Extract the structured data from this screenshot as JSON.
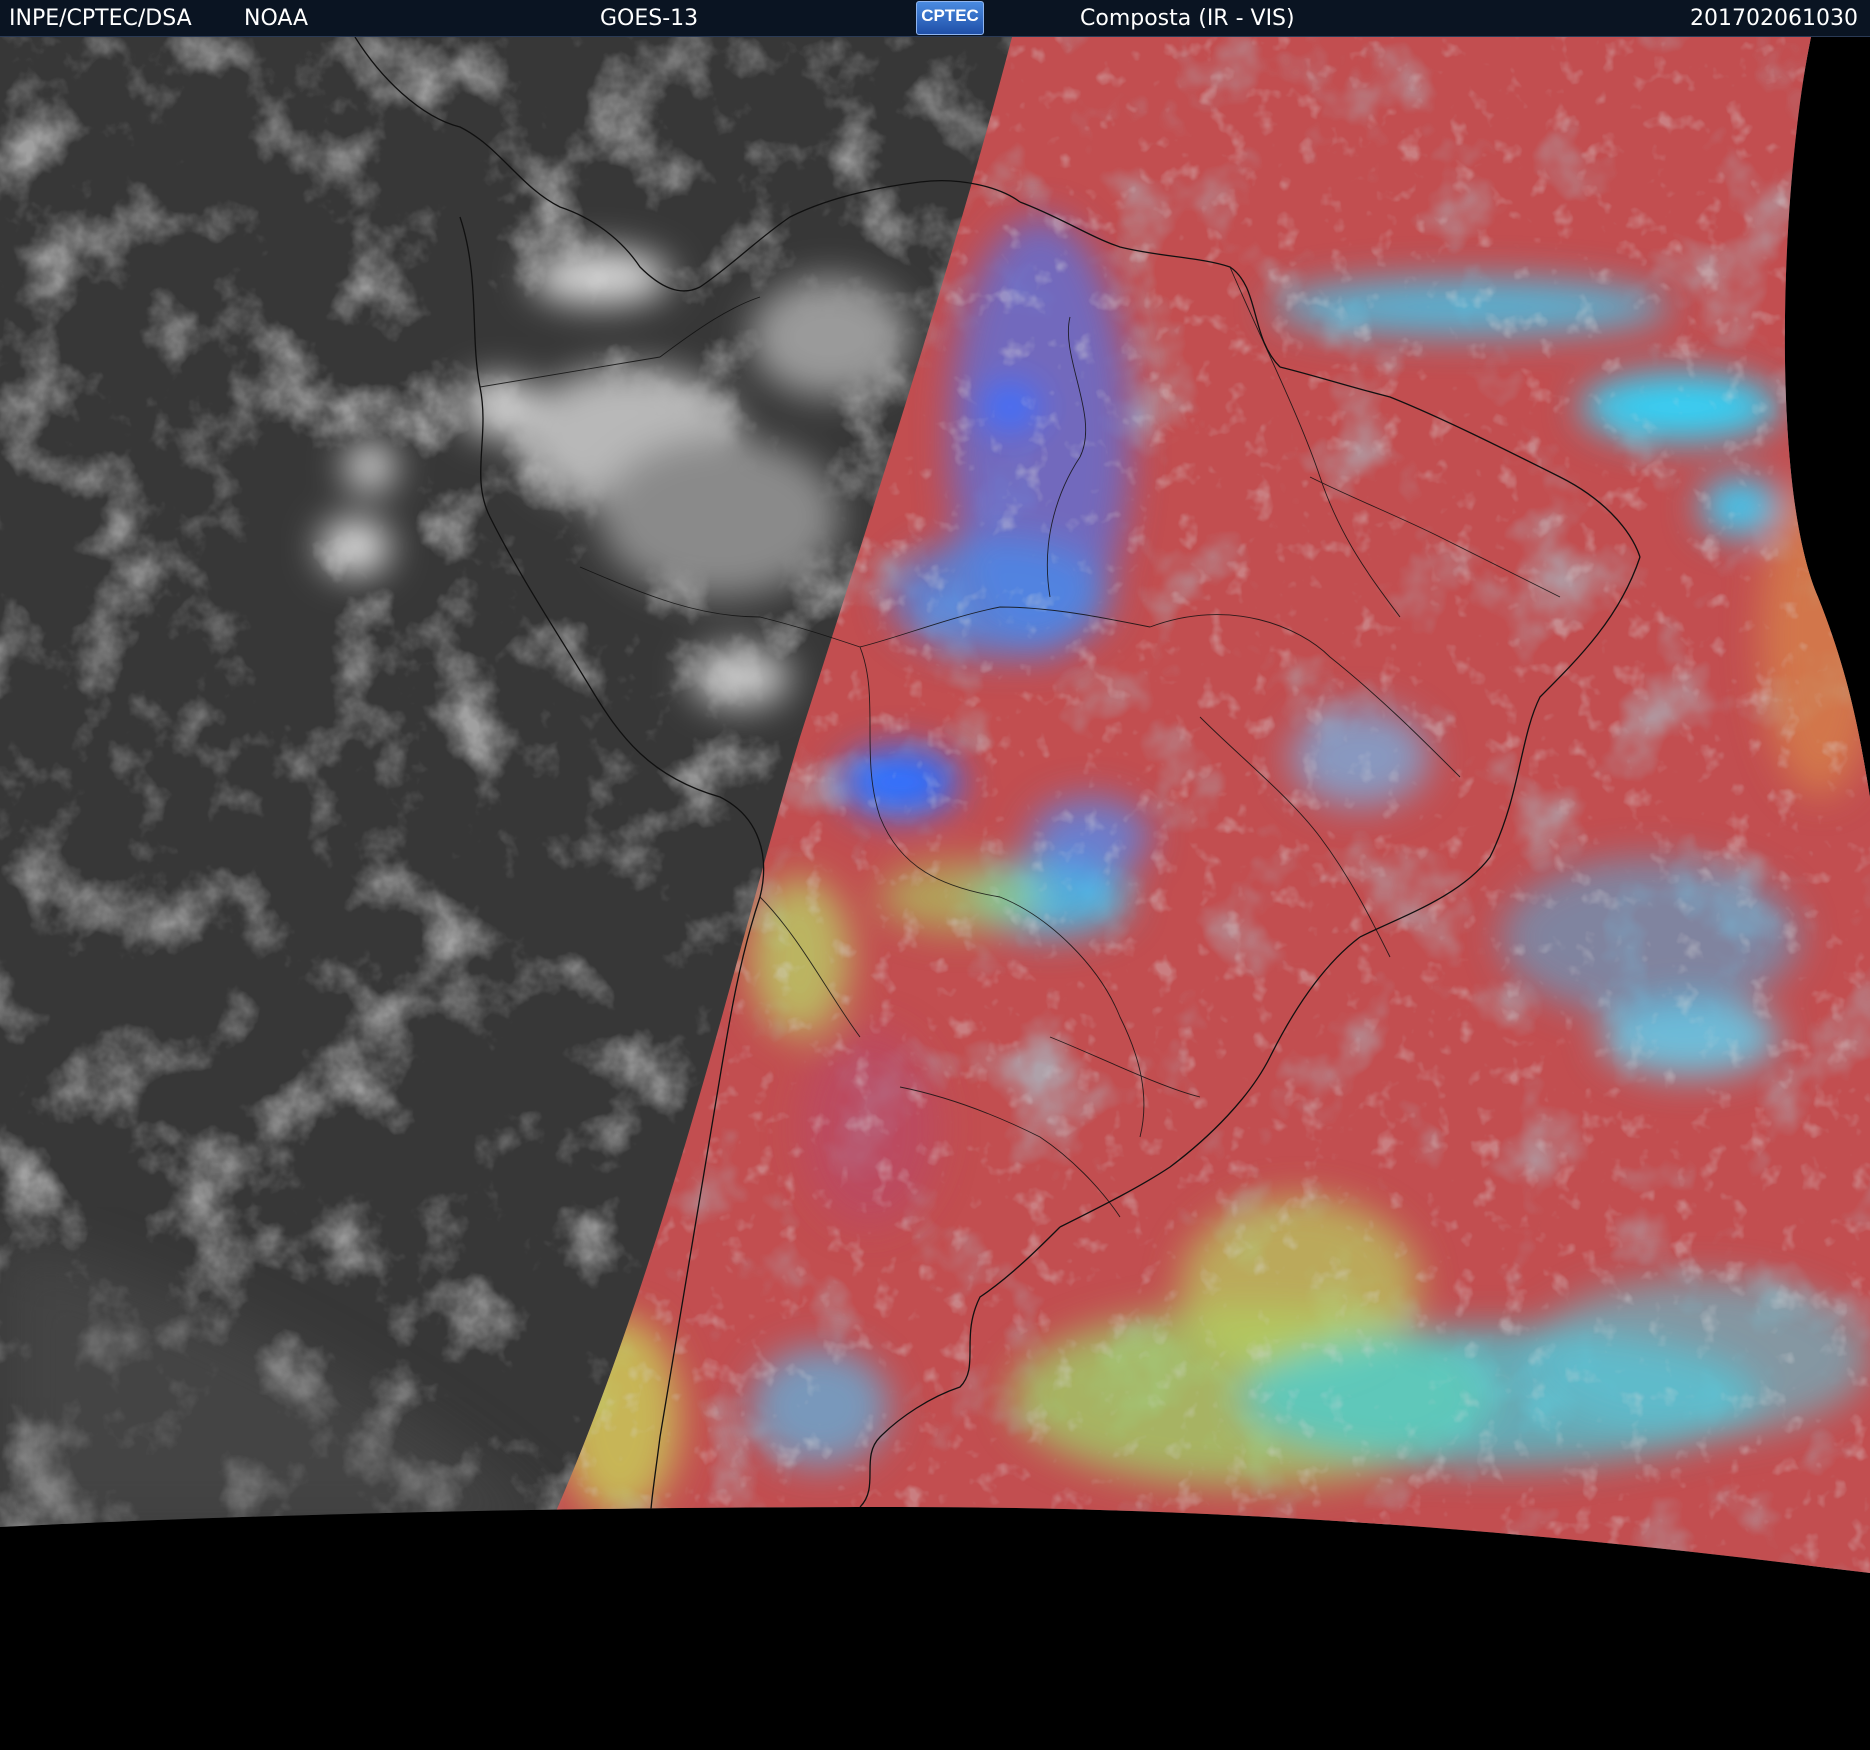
{
  "header": {
    "agency": "INPE/CPTEC/DSA",
    "source": "NOAA",
    "satellite": "GOES-13",
    "logo_text": "CPTEC",
    "product": "Composta (IR - VIS)",
    "timestamp": "201702061030"
  },
  "colors": {
    "header_bg": "#0a1422",
    "ir_ocean": "#3a3a3a",
    "vis_land": "#b8484a",
    "vis_ocean": "#c05050",
    "cloud_cyan": "#38c8e8",
    "cloud_blue": "#2f6fff",
    "cloud_green": "#9ad86a",
    "no_data": "#000000"
  }
}
